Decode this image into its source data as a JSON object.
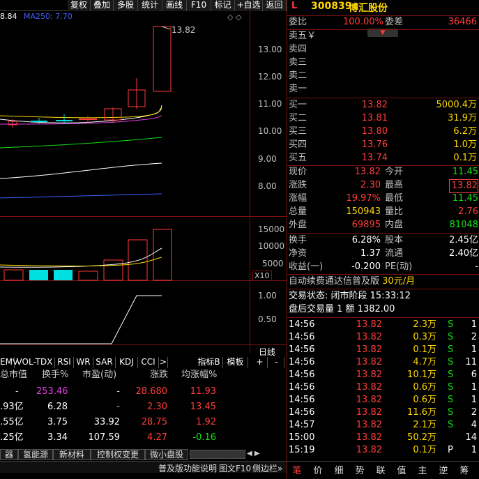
{
  "toolbar": {
    "items": [
      "复权",
      "叠加",
      "多股",
      "统计",
      "画线",
      "F10",
      "标记",
      "+自选",
      "返回"
    ]
  },
  "legend": {
    "ma_text": "8.84",
    "ma250": "MA250: 7.70"
  },
  "price_axis": [
    "13.00",
    "12.00",
    "11.00",
    "10.00",
    "9.00",
    "8.00"
  ],
  "high_label": "13.82",
  "volume_axis": [
    "15000",
    "10000",
    "5000"
  ],
  "volume_unit": "X10",
  "ind_axis": [
    "1.00",
    "0.50"
  ],
  "period": "日线",
  "ind_tabs": [
    "EMV",
    "VOL-TDX",
    "RSI",
    "WR",
    "SAR",
    "KDJ",
    "CCI",
    ">"
  ],
  "ind_tab_right": [
    "指标B",
    "模板",
    "+",
    "-"
  ],
  "table": {
    "headers": [
      "总市值",
      "换手%",
      "市盈(动)",
      "涨跌",
      "均涨幅%"
    ],
    "rows": [
      [
        "-",
        "253.46",
        "-",
        "28.680",
        "11.93"
      ],
      [
        ".93亿",
        "6.28",
        "-",
        "2.30",
        "13.45"
      ],
      [
        ".55亿",
        "3.75",
        "33.92",
        "28.75",
        "1.92"
      ],
      [
        ".25亿",
        "3.34",
        "107.59",
        "4.27",
        "-0.16"
      ]
    ]
  },
  "bottom_tabs": [
    "器",
    "氢能源",
    "新材料",
    "控制权变更",
    "微小盘股"
  ],
  "status_links": [
    "普及版功能说明",
    "图文F10",
    "侧边栏»"
  ],
  "stock": {
    "code_prefix": "L",
    "code": "300839",
    "name": "博汇股份"
  },
  "webi": {
    "label": "委比",
    "value": "100.00%",
    "diff_label": "委差",
    "diff": "36466"
  },
  "asks": [
    {
      "label": "卖五",
      "mark": "￥"
    },
    {
      "label": "卖四"
    },
    {
      "label": "卖三"
    },
    {
      "label": "卖二"
    },
    {
      "label": "卖一"
    }
  ],
  "bids": [
    {
      "label": "买一",
      "price": "13.82",
      "vol": "5000.4万"
    },
    {
      "label": "买二",
      "price": "13.81",
      "vol": "31.9万"
    },
    {
      "label": "买三",
      "price": "13.80",
      "vol": "6.2万"
    },
    {
      "label": "买四",
      "price": "13.76",
      "vol": "1.0万"
    },
    {
      "label": "买五",
      "price": "13.74",
      "vol": "0.1万"
    }
  ],
  "quote": [
    {
      "l1": "现价",
      "v1": "13.82",
      "l2": "今开",
      "v2": "11.45"
    },
    {
      "l1": "涨跌",
      "v1": "2.30",
      "l2": "最高",
      "v2": "13.82"
    },
    {
      "l1": "涨幅",
      "v1": "19.97%",
      "l2": "最低",
      "v2": "11.45"
    },
    {
      "l1": "总量",
      "v1": "150943",
      "l2": "量比",
      "v2": "2.76"
    },
    {
      "l1": "外盘",
      "v1": "69895",
      "l2": "内盘",
      "v2": "81048"
    }
  ],
  "stats": [
    {
      "l1": "换手",
      "v1": "6.28%",
      "l2": "股本",
      "v2": "2.45亿"
    },
    {
      "l1": "净资",
      "v1": "1.37",
      "l2": "流通",
      "v2": "2.40亿"
    },
    {
      "l1": "收益(一)",
      "v1": "-0.200",
      "l2": "PE(动)",
      "v2": "-"
    }
  ],
  "promo": {
    "text": "自动续费通达信普及版",
    "price": "30元/月"
  },
  "trade_status": "交易状态: 闭市阶段 15:33:12",
  "after_hours": "盘后交易量 1 额 1382.00",
  "ticks": [
    {
      "t": "14:56",
      "p": "13.82",
      "v": "2.3万",
      "d": "S",
      "n": "1"
    },
    {
      "t": "14:56",
      "p": "13.82",
      "v": "0.3万",
      "d": "S",
      "n": "2"
    },
    {
      "t": "14:56",
      "p": "13.82",
      "v": "0.1万",
      "d": "S",
      "n": "1"
    },
    {
      "t": "14:56",
      "p": "13.82",
      "v": "4.7万",
      "d": "S",
      "n": "11"
    },
    {
      "t": "14:56",
      "p": "13.82",
      "v": "10.1万",
      "d": "S",
      "n": "6"
    },
    {
      "t": "14:56",
      "p": "13.82",
      "v": "0.6万",
      "d": "S",
      "n": "1"
    },
    {
      "t": "14:56",
      "p": "13.82",
      "v": "0.6万",
      "d": "S",
      "n": "1"
    },
    {
      "t": "14:56",
      "p": "13.82",
      "v": "11.6万",
      "d": "S",
      "n": "2"
    },
    {
      "t": "14:57",
      "p": "13.82",
      "v": "2.1万",
      "d": "S",
      "n": "4"
    },
    {
      "t": "15:00",
      "p": "13.82",
      "v": "50.2万",
      "d": "",
      "n": "14"
    },
    {
      "t": "15:19",
      "p": "13.82",
      "v": "0.1万",
      "d": "P",
      "n": "1"
    }
  ],
  "right_nav": [
    "笔",
    "价",
    "细",
    "势",
    "联",
    "值",
    "主",
    "逆",
    "筹"
  ],
  "colors": {
    "up": "#ff3c3c",
    "down": "#10e010",
    "grid": "#7a1010",
    "flat": "#00e0e0"
  }
}
